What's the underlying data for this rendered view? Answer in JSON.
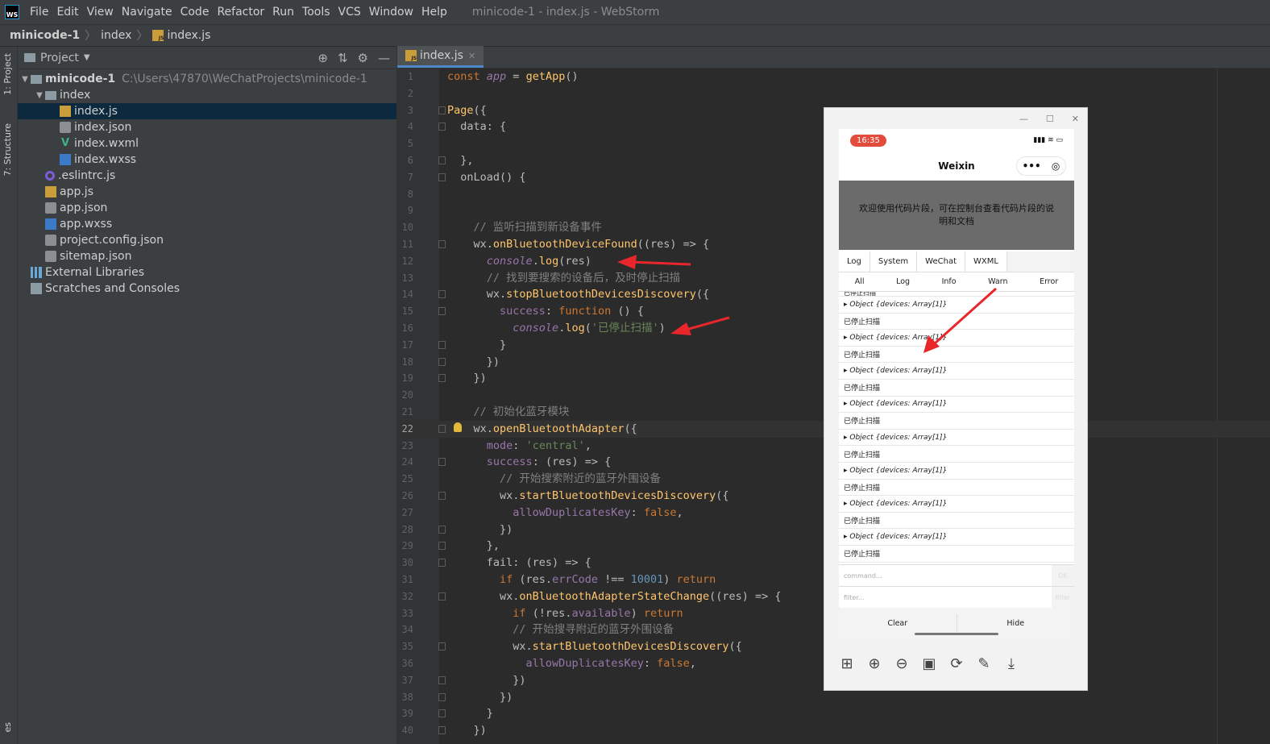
{
  "window": {
    "title": "minicode-1 - index.js - WebStorm",
    "logo": "WS"
  },
  "menu": [
    "File",
    "Edit",
    "View",
    "Navigate",
    "Code",
    "Refactor",
    "Run",
    "Tools",
    "VCS",
    "Window",
    "Help"
  ],
  "breadcrumb": [
    "minicode-1",
    "index",
    "index.js"
  ],
  "toolwindows": {
    "project": "1: Project",
    "structure": "7: Structure",
    "bottom": "es"
  },
  "project": {
    "header": "Project",
    "root": {
      "name": "minicode-1",
      "path": "C:\\Users\\47870\\WeChatProjects\\minicode-1"
    },
    "items": [
      {
        "name": "index",
        "type": "folder",
        "depth": 1
      },
      {
        "name": "index.js",
        "type": "js",
        "depth": 2,
        "selected": true
      },
      {
        "name": "index.json",
        "type": "json",
        "depth": 2
      },
      {
        "name": "index.wxml",
        "type": "wxml",
        "depth": 2
      },
      {
        "name": "index.wxss",
        "type": "wxss",
        "depth": 2
      },
      {
        "name": ".eslintrc.js",
        "type": "eslint",
        "depth": 1
      },
      {
        "name": "app.js",
        "type": "js",
        "depth": 1
      },
      {
        "name": "app.json",
        "type": "json",
        "depth": 1
      },
      {
        "name": "app.wxss",
        "type": "wxss",
        "depth": 1
      },
      {
        "name": "project.config.json",
        "type": "json",
        "depth": 1
      },
      {
        "name": "sitemap.json",
        "type": "json",
        "depth": 1
      },
      {
        "name": "External Libraries",
        "type": "lib",
        "depth": 0
      },
      {
        "name": "Scratches and Consoles",
        "type": "scr",
        "depth": 0
      }
    ]
  },
  "editor": {
    "tab": "index.js",
    "current_line": 22,
    "lines": [
      "const app = getApp()",
      "",
      "Page({",
      "  data: {",
      "",
      "  },",
      "  onLoad() {",
      "",
      "",
      "    // 监听扫描到新设备事件",
      "    wx.onBluetoothDeviceFound((res) => {",
      "      console.log(res)",
      "      // 找到要搜索的设备后，及时停止扫描",
      "      wx.stopBluetoothDevicesDiscovery({",
      "        success: function () {",
      "          console.log('已停止扫描')",
      "        }",
      "      })",
      "    })",
      "",
      "    // 初始化蓝牙模块",
      "    wx.openBluetoothAdapter({",
      "      mode: 'central',",
      "      success: (res) => {",
      "        // 开始搜索附近的蓝牙外围设备",
      "        wx.startBluetoothDevicesDiscovery({",
      "          allowDuplicatesKey: false,",
      "        })",
      "      },",
      "      fail: (res) => {",
      "        if (res.errCode !== 10001) return",
      "        wx.onBluetoothAdapterStateChange((res) => {",
      "          if (!res.available) return",
      "          // 开始搜寻附近的蓝牙外围设备",
      "          wx.startBluetoothDevicesDiscovery({",
      "            allowDuplicatesKey: false,",
      "          })",
      "        })",
      "      }",
      "    })"
    ]
  },
  "simulator": {
    "time": "16:35",
    "nav_title": "Weixin",
    "capsule": [
      "•••",
      "◎"
    ],
    "banner": "欢迎使用代码片段，可在控制台查看代码片段的说明和文档",
    "console_tabs": [
      "Log",
      "System",
      "WeChat",
      "WXML"
    ],
    "filters": [
      "All",
      "Log",
      "Info",
      "Warn",
      "Error"
    ],
    "log_partial": "已停止扫描",
    "logs": [
      "▸ Object {devices: Array[1]}",
      "已停止扫描",
      "▸ Object {devices: Array[1]}",
      "已停止扫描",
      "▸ Object {devices: Array[1]}",
      "已停止扫描",
      "▸ Object {devices: Array[1]}",
      "已停止扫描",
      "▸ Object {devices: Array[1]}",
      "已停止扫描",
      "▸ Object {devices: Array[1]}",
      "已停止扫描",
      "▸ Object {devices: Array[1]}",
      "已停止扫描",
      "▸ Object {devices: Array[1]}",
      "已停止扫描"
    ],
    "command_placeholder": "command...",
    "command_button": "OK",
    "filter_placeholder": "filter...",
    "filter_button": "filter",
    "clear_label": "Clear",
    "hide_label": "Hide"
  }
}
